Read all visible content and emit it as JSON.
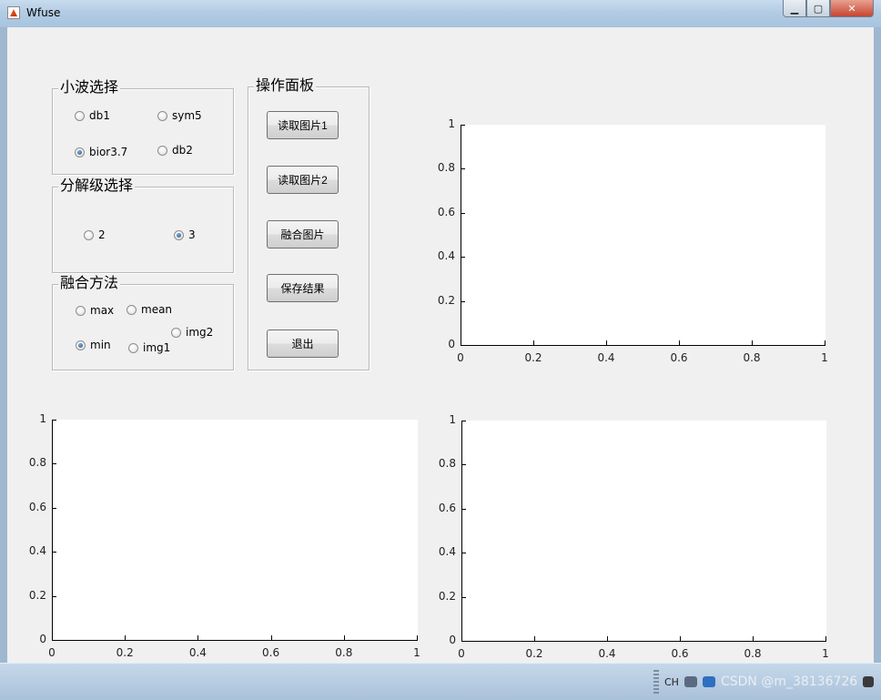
{
  "window": {
    "title": "Wfuse"
  },
  "wavelet_panel": {
    "title": "小波选择",
    "options": [
      {
        "label": "db1",
        "checked": false
      },
      {
        "label": "sym5",
        "checked": false
      },
      {
        "label": "bior3.7",
        "checked": true
      },
      {
        "label": "db2",
        "checked": false
      }
    ]
  },
  "level_panel": {
    "title": "分解级选择",
    "options": [
      {
        "label": "2",
        "checked": false
      },
      {
        "label": "3",
        "checked": true
      }
    ]
  },
  "fusion_panel": {
    "title": "融合方法",
    "options": [
      {
        "label": "max",
        "checked": false
      },
      {
        "label": "mean",
        "checked": false
      },
      {
        "label": "img2",
        "checked": false
      },
      {
        "label": "min",
        "checked": true
      },
      {
        "label": "img1",
        "checked": false
      }
    ]
  },
  "operation_panel": {
    "title": "操作面板",
    "buttons": [
      "读取图片1",
      "读取图片2",
      "融合图片",
      "保存结果",
      "退出"
    ]
  },
  "axes_ticks": {
    "y": [
      "1",
      "0.8",
      "0.6",
      "0.4",
      "0.2",
      "0"
    ],
    "x": [
      "0",
      "0.2",
      "0.4",
      "0.6",
      "0.8",
      "1"
    ]
  },
  "taskbar": {
    "ime": "CH",
    "watermark": "CSDN @m_38136726"
  }
}
